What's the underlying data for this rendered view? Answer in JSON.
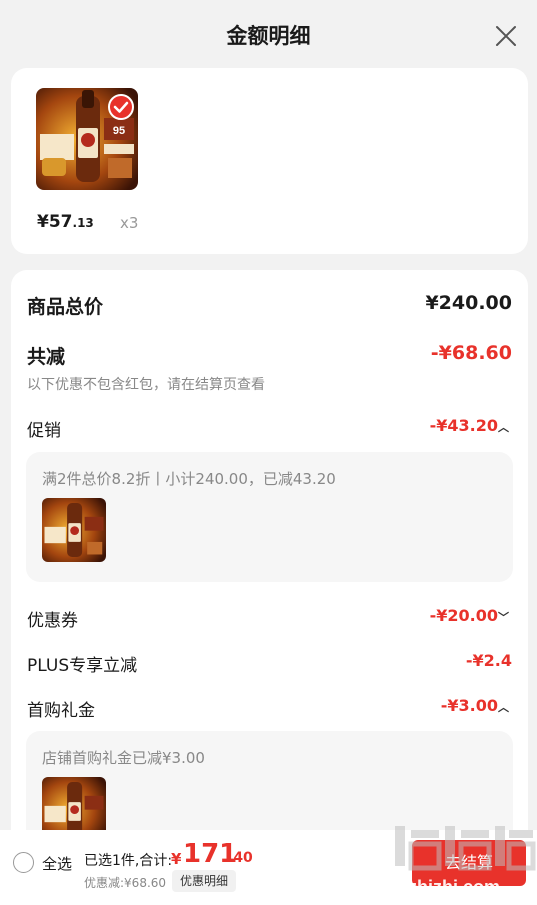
{
  "header": {
    "title": "金额明细"
  },
  "product": {
    "price_currency": "¥",
    "price_int": "57",
    "price_dec": ".13",
    "quantity": "x3",
    "thumb_score": "95"
  },
  "summary": {
    "total_label": "商品总价",
    "total_value": "¥240.00",
    "reduce_label": "共减",
    "reduce_value": "-¥68.60",
    "reduce_note": "以下优惠不包含红包，请在结算页查看"
  },
  "promotion": {
    "label": "促销",
    "value": "-¥43.20",
    "detail": "满2件总价8.2折丨小计240.00，已减43.20"
  },
  "coupon": {
    "label": "优惠券",
    "value": "-¥20.00"
  },
  "plus": {
    "label": "PLUS专享立减",
    "value": "-¥2.4"
  },
  "first_gift": {
    "label": "首购礼金",
    "value": "-¥3.00",
    "detail": "店铺首购礼金已减¥3.00"
  },
  "bottom": {
    "select_all": "全选",
    "selected_label": "已选1件,合计:",
    "total_currency": "¥",
    "total_int": "171",
    "total_dec": ".40",
    "discount_line": "优惠减:¥68.60",
    "detail_button": "优惠明细",
    "checkout_button": "去结算"
  },
  "watermark": {
    "text": "zhizhizhi.com"
  },
  "colors": {
    "accent": "#e8322b",
    "background": "#f2f2f2",
    "card": "#ffffff"
  }
}
